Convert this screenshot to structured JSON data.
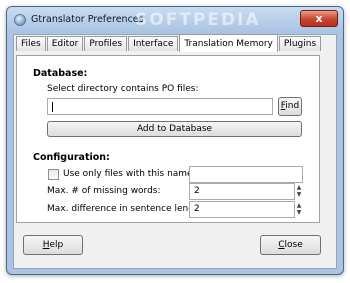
{
  "window": {
    "title": "Gtranslator Preferences",
    "watermark": "SOFTPEDIA",
    "close_glyph": "x"
  },
  "tabs": [
    {
      "label": "Files",
      "active": false
    },
    {
      "label": "Editor",
      "active": false
    },
    {
      "label": "Profiles",
      "active": false
    },
    {
      "label": "Interface",
      "active": false
    },
    {
      "label": "Translation Memory",
      "active": true
    },
    {
      "label": "Plugins",
      "active": false
    }
  ],
  "database": {
    "heading": "Database:",
    "dir_label": "Select directory contains PO files:",
    "dir_value": "",
    "find_label_first": "F",
    "find_label_rest": "ind",
    "add_button": "Add to Database"
  },
  "configuration": {
    "heading": "Configuration:",
    "use_only_label": "Use only files with this name:",
    "use_only_checked": false,
    "use_only_value": "",
    "missing_words_label": "Max. # of missing words:",
    "missing_words_value": "2",
    "sentence_diff_label": "Max. difference in sentence length:",
    "sentence_diff_value": "2"
  },
  "footer": {
    "help_first": "H",
    "help_rest": "elp",
    "close_first": "C",
    "close_rest": "lose"
  },
  "icons": {
    "app": "gtranslator-app-icon",
    "spin_up": "▲",
    "spin_down": "▼"
  },
  "colors": {
    "title_bar": "#a9c3e2",
    "close_button": "#c8452e",
    "dialog_bg": "#f0f0f0"
  }
}
